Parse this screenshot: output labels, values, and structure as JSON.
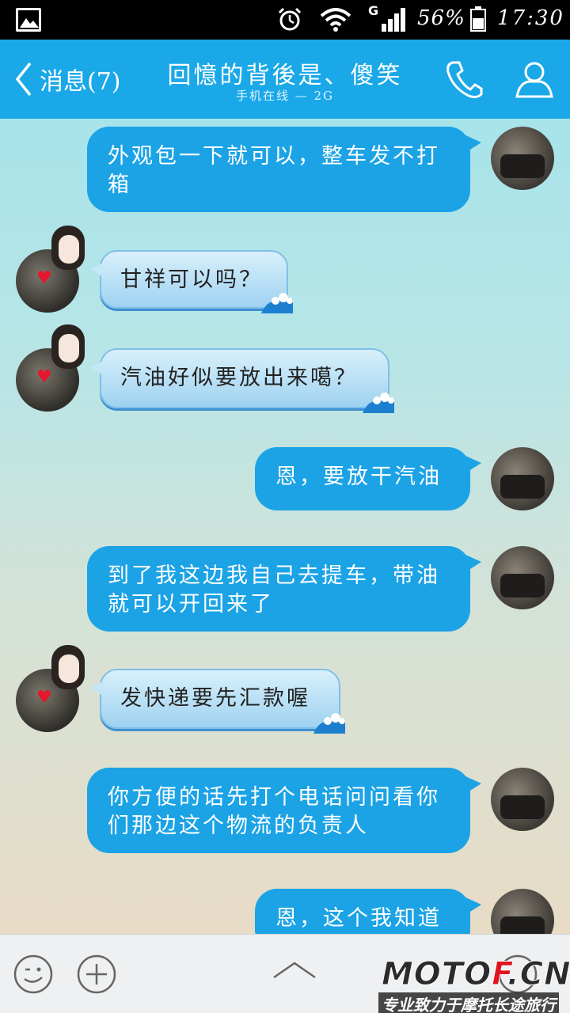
{
  "statusbar": {
    "battery_pct": "56%",
    "network": "G",
    "time": "17:30"
  },
  "header": {
    "back_label": "消息(7)",
    "title": "回憶的背後是、傻笑",
    "subtitle": "手机在线 — 2G"
  },
  "messages": [
    {
      "side": "out",
      "text": "外观包一下就可以，整车发不打箱"
    },
    {
      "side": "in",
      "text": "甘祥可以吗？"
    },
    {
      "side": "in",
      "text": "汽油好似要放出来噶？"
    },
    {
      "side": "out",
      "text": "恩，要放干汽油"
    },
    {
      "side": "out",
      "text": "到了我这边我自己去提车，带油就可以开回来了"
    },
    {
      "side": "in",
      "text": "发快递要先汇款喔"
    },
    {
      "side": "out",
      "text": "你方便的话先打个电话问问看你们那边这个物流的负责人"
    },
    {
      "side": "out",
      "text": "恩，这个我知道"
    }
  ],
  "watermark": {
    "brand_a": "MOTO",
    "brand_b": "F",
    "brand_c": ".CN",
    "tagline": "专业致力于摩托长途旅行"
  },
  "colors": {
    "header": "#1aa8e8",
    "bubble_out": "#1ba3e6",
    "bubble_in": "#9fd2f1"
  }
}
